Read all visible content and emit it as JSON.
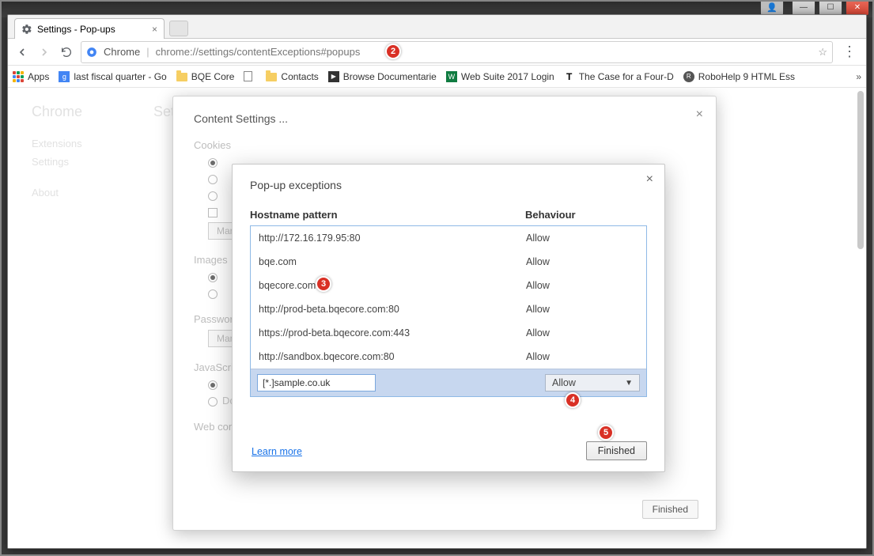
{
  "window": {
    "tab_title": "Settings - Pop-ups"
  },
  "toolbar": {
    "chip": "Chrome",
    "url": "chrome://settings/contentExceptions#popups"
  },
  "bookmarks": {
    "apps": "Apps",
    "items": [
      "last fiscal quarter - Go",
      "BQE Core",
      "",
      "Contacts",
      "Browse Documentarie",
      "Web Suite 2017 Login",
      "The Case for a Four-D",
      "RoboHelp 9 HTML Ess"
    ]
  },
  "faded": {
    "brand": "Chrome",
    "heading": "Settings",
    "left_items": [
      "Extensions",
      "Settings",
      "About"
    ],
    "cookies": "Cookies",
    "images": "Images",
    "passwords": "Passwords",
    "javascript": "JavaScript",
    "webcontent": "Web content",
    "manage": "Manage exceptions...",
    "js_off": "Do not allow any site to run JavaScript"
  },
  "dialog1": {
    "title": "Content Settings ...",
    "finished": "Finished"
  },
  "dialog2": {
    "title": "Pop-up exceptions",
    "col_hostname": "Hostname pattern",
    "col_behaviour": "Behaviour",
    "rows": [
      {
        "pattern": "http://172.16.179.95:80",
        "behaviour": "Allow"
      },
      {
        "pattern": "bqe.com",
        "behaviour": "Allow"
      },
      {
        "pattern": "bqecore.com",
        "behaviour": "Allow"
      },
      {
        "pattern": "http://prod-beta.bqecore.com:80",
        "behaviour": "Allow"
      },
      {
        "pattern": "https://prod-beta.bqecore.com:443",
        "behaviour": "Allow"
      },
      {
        "pattern": "http://sandbox.bqecore.com:80",
        "behaviour": "Allow"
      }
    ],
    "input_value": "[*.]sample.co.uk",
    "select_value": "Allow",
    "learn_more": "Learn more",
    "finished": "Finished"
  },
  "badges": {
    "b2": "2",
    "b3": "3",
    "b4": "4",
    "b5": "5"
  }
}
